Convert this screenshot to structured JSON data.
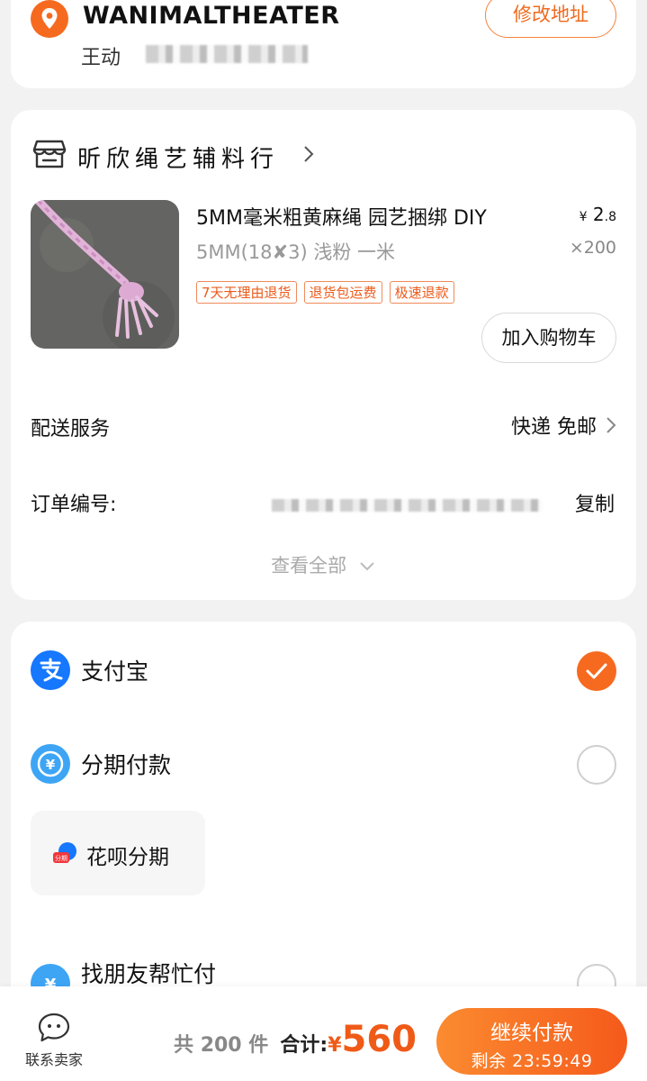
{
  "colors": {
    "accent": "#f55a1b",
    "accent_light": "#fb8b30",
    "alipay_blue": "#1677ff",
    "tag_red": "#ec5b1b"
  },
  "address": {
    "name": "WANIMALTHEATER",
    "person": "王动",
    "edit_label": "修改地址",
    "icon": "location-pin-icon"
  },
  "order": {
    "store_name": "昕欣绳艺辅料行",
    "store_icon": "store-icon",
    "product": {
      "title": "5MM毫米粗黄麻绳 园艺捆绑 DIY",
      "spec": "5MM(18✘3) 浅粉  一米",
      "price_currency": "¥",
      "price_int": "2",
      "price_dec": ".8",
      "quantity": "×200",
      "tags": [
        "7天无理由退货",
        "退货包运费",
        "极速退款"
      ],
      "cart_label": "加入购物车"
    },
    "delivery_label": "配送服务",
    "delivery_value": "快递 免邮",
    "orderno_label": "订单编号:",
    "copy_label": "复制",
    "view_all_label": "查看全部"
  },
  "payment": {
    "options": [
      {
        "label": "支付宝",
        "icon": "alipay-icon",
        "selected": true
      },
      {
        "label": "分期付款",
        "icon": "installment-icon",
        "selected": false
      },
      {
        "label": "找朋友帮忙付",
        "icon": "friend-pay-icon",
        "selected": false
      }
    ],
    "huabei_label": "花呗分期",
    "huabei_icon": "huabei-icon"
  },
  "bottom": {
    "contact_label": "联系卖家",
    "count_text": "共 200 件",
    "total_label": "合计:",
    "total_currency": "¥",
    "total_value": "560",
    "pay_label": "继续付款",
    "timer_text": "剩余 23:59:49"
  }
}
